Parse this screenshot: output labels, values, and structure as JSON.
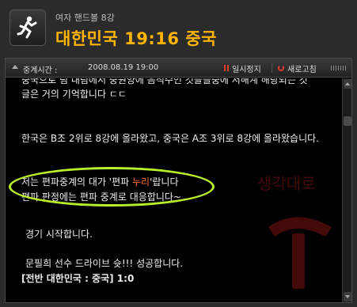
{
  "header": {
    "subtitle": "여자 핸드볼 8강",
    "title": "대한민국 19:16 중국",
    "sport_icon": "handball-player-icon"
  },
  "toolbar": {
    "relay_label": "중계시간 :",
    "relay_time": "2008.08.19 19:00",
    "pause_label": "일시정지",
    "refresh_label": "새로고침"
  },
  "commentary": {
    "line0": "중국으로 팀 내림에서 중원양에 음적수인 것들을중에 저해계 해당되는 것",
    "line1": "글은 거의 기억합니다 ㄷㄷ",
    "line2": "한국은 B조 2위로 8강에 올라왔고, 중국은 A조 3위로 8강에 올라왔습니다.",
    "line3_pre": "저는 편파중계의 대가 '편파 ",
    "line3_hl": "누리",
    "line3_post": "'랍니다",
    "line4": "편파 판정에는 편파 중계로 대응합니다~",
    "line5": "경기 시작합니다.",
    "line6": "문필희 선수 드라이브 슛!!! 성공합니다.",
    "line7": "[전반 대한민국 : 중국] 1:0"
  },
  "watermark": {
    "text": "생각대로",
    "icon": "t-logo-watermark"
  },
  "colors": {
    "title": "#ffb400",
    "highlight": "#ff6a3d",
    "annotation_oval": "#b8ee2a",
    "accent": "#e23b2e"
  }
}
